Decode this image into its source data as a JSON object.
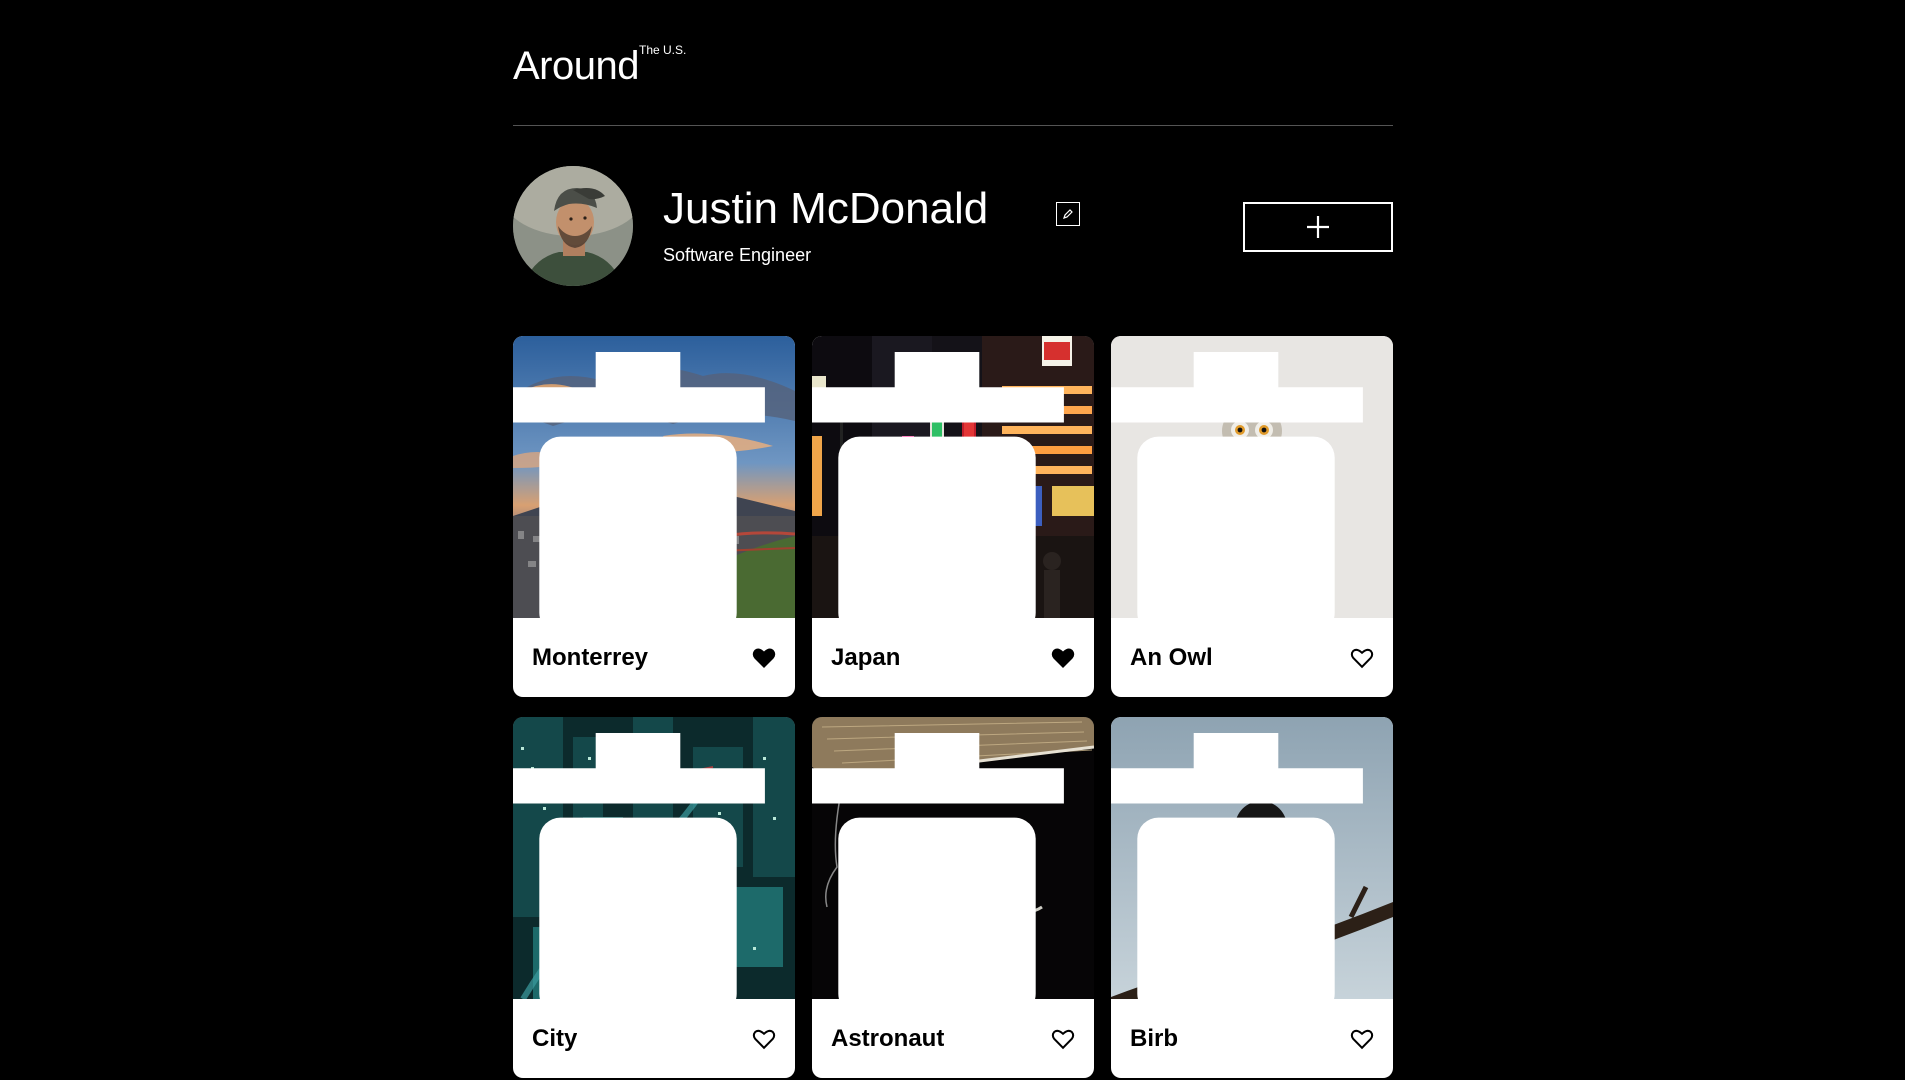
{
  "header": {
    "logo": "Around",
    "logo_sup": "The U.S."
  },
  "profile": {
    "name": "Justin McDonald",
    "job": "Software Engineer",
    "edit_icon": "pencil-icon",
    "add_icon": "plus-icon"
  },
  "cards": [
    {
      "title": "Monterrey",
      "liked": true,
      "image": "mountain-city-sunset"
    },
    {
      "title": "Japan",
      "liked": true,
      "image": "neon-street-night"
    },
    {
      "title": "An Owl",
      "liked": false,
      "image": "owl-on-stump"
    },
    {
      "title": "City",
      "liked": false,
      "image": "aerial-city-night"
    },
    {
      "title": "Astronaut",
      "liked": false,
      "image": "astronaut-spacewalk"
    },
    {
      "title": "Birb",
      "liked": false,
      "image": "chickadee-on-branch"
    }
  ],
  "colors": {
    "background": "#000000",
    "card": "#ffffff",
    "divider": "#545454"
  }
}
